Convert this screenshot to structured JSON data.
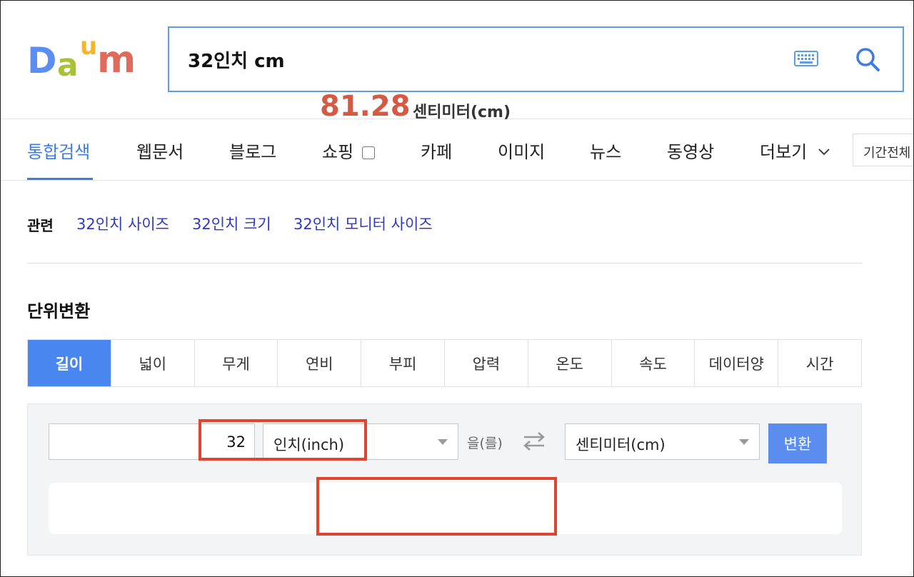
{
  "header": {
    "logo_letters": [
      "D",
      "a",
      "u",
      "m"
    ],
    "search_query": "32인치 cm",
    "colors": {
      "search_border": "#5f9ce6",
      "accent": "#3e7be5"
    }
  },
  "tabs": {
    "items": [
      {
        "label": "통합검색",
        "active": true
      },
      {
        "label": "웹문서"
      },
      {
        "label": "블로그"
      },
      {
        "label": "쇼핑"
      },
      {
        "label": "카페"
      },
      {
        "label": "이미지"
      },
      {
        "label": "뉴스"
      },
      {
        "label": "동영상"
      },
      {
        "label": "더보기"
      }
    ],
    "period_label": "기간전체"
  },
  "related": {
    "label": "관련",
    "links": [
      "32인치 사이즈",
      "32인치 크기",
      "32인치 모니터 사이즈"
    ]
  },
  "unit_converter": {
    "title": "단위변환",
    "categories": [
      "길이",
      "넓이",
      "무게",
      "연비",
      "부피",
      "압력",
      "온도",
      "속도",
      "데이터양",
      "시간"
    ],
    "active_category": "길이",
    "input_value": "32",
    "from_unit": "인치(inch)",
    "particle": "을(를)",
    "to_unit": "센티미터(cm)",
    "convert_label": "변환",
    "result_value": "81.28",
    "result_unit": "센티미터(cm)",
    "colors": {
      "active_tab": "#4a86f0",
      "button": "#5b8def",
      "result": "#d45a45",
      "highlight": "#e0442e"
    }
  }
}
